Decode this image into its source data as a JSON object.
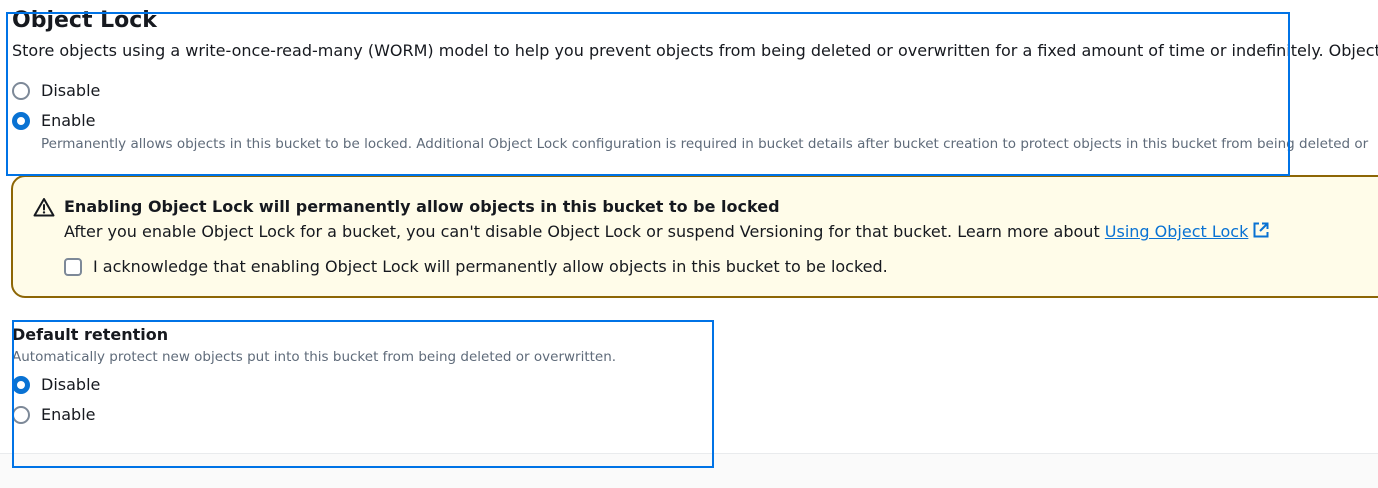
{
  "object_lock": {
    "title": "Object Lock",
    "description": "Store objects using a write-once-read-many (WORM) model to help you prevent objects from being deleted or overwritten for a fixed amount of time or indefinitely. Object L",
    "options": {
      "disable_label": "Disable",
      "enable_label": "Enable",
      "enable_hint": "Permanently allows objects in this bucket to be locked. Additional Object Lock configuration is required in bucket details after bucket creation to protect objects in this bucket from being deleted or",
      "selected": "Enable"
    }
  },
  "alert": {
    "icon": "warning-icon",
    "title": "Enabling Object Lock will permanently allow objects in this bucket to be locked",
    "body_text": "After you enable Object Lock for a bucket, you can't disable Object Lock or suspend Versioning for that bucket. Learn more about ",
    "link_text": "Using Object Lock",
    "acknowledge_label": "I acknowledge that enabling Object Lock will permanently allow objects in this bucket to be locked.",
    "acknowledged": false,
    "colors": {
      "background": "#fffce9",
      "border": "#8d6605"
    }
  },
  "default_retention": {
    "title": "Default retention",
    "description": "Automatically protect new objects put into this bucket from being deleted or overwritten.",
    "options": {
      "disable_label": "Disable",
      "enable_label": "Enable",
      "selected": "Disable"
    }
  },
  "colors": {
    "accent": "#0972d3",
    "highlight": "#0073e6"
  }
}
